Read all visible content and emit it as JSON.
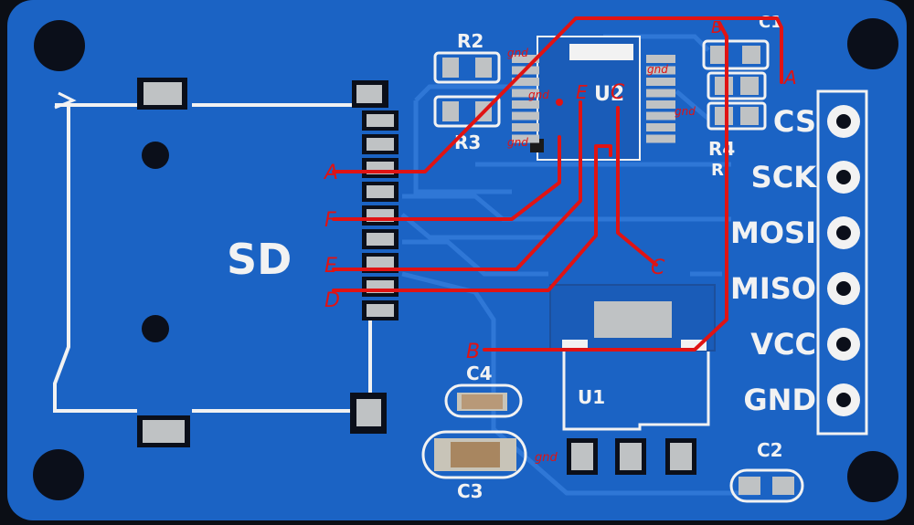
{
  "board": {
    "sd_label": "SD",
    "component_labels": {
      "r2": "R2",
      "r3": "R3",
      "r4": "R4",
      "r5": "R",
      "u2": "U2",
      "c1": "C1",
      "c2": "C2",
      "c3": "C3",
      "c4": "C4",
      "u1": "U1"
    },
    "pin_labels": [
      "CS",
      "SCK",
      "MOSI",
      "MISO",
      "VCC",
      "GND"
    ]
  },
  "annotations": {
    "gnd": "gnd",
    "letters": {
      "A_left": "A",
      "A_right": "A",
      "B_bottom": "B",
      "B_top": "B",
      "C_left": "C",
      "C_right": "C",
      "D": "D",
      "E_left": "E",
      "E_top": "E",
      "F": "F"
    }
  },
  "colors": {
    "pcb": "#1b63c4",
    "trace": "#2f77d6",
    "silkscreen": "#f2f2f2",
    "pad": "#bfc2c4",
    "annotation": "#e01313",
    "ic_body": "#1a1a1a"
  }
}
